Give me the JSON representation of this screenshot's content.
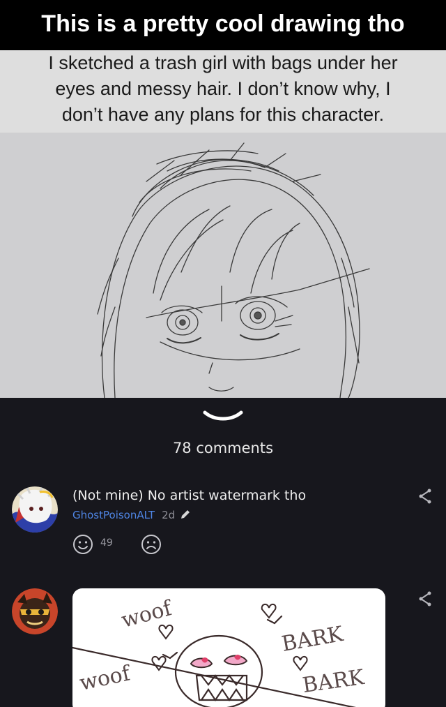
{
  "post": {
    "title": "This is a pretty cool drawing tho"
  },
  "meme": {
    "caption_lines": [
      "I sketched a trash girl with bags under her",
      "eyes and messy hair. I don’t know why, I",
      "don’t have any plans for this character."
    ]
  },
  "comments_header": {
    "count_label": "78 comments"
  },
  "comments": [
    {
      "text": "(Not mine) No artist watermark tho",
      "username": "GhostPoisonALT",
      "timestamp": "2d",
      "upvotes": "49"
    },
    {
      "image_words": [
        "woof",
        "woof",
        "BARK",
        "BARK"
      ]
    }
  ],
  "icons": {
    "share": "share-icon",
    "pencil": "pencil-icon",
    "upvote": "smile-face-icon",
    "downvote": "frown-face-icon",
    "expand": "chevron-down-icon"
  },
  "colors": {
    "background": "#17171d",
    "username": "#4f86e6",
    "title_bar": "#000000"
  }
}
